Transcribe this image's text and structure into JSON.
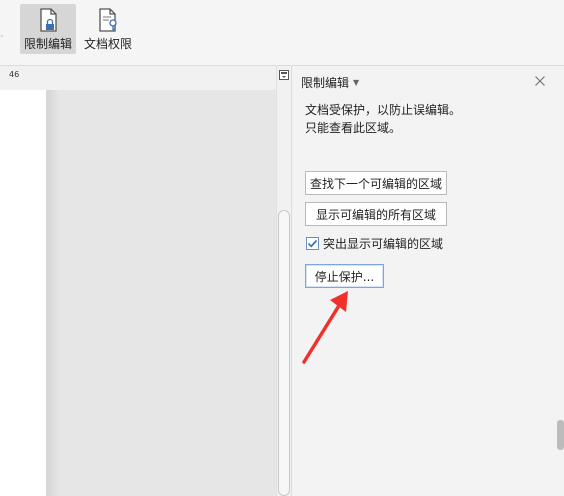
{
  "ribbon": {
    "separator": "-",
    "restrict_edit_label": "限制编辑",
    "doc_permission_label": "文档权限"
  },
  "ruler": {
    "number": "46"
  },
  "pane": {
    "title": "限制编辑",
    "desc_line1": "文档受保护，以防止误编辑。",
    "desc_line2": "只能查看此区域。",
    "find_next_label": "查找下一个可编辑的区域",
    "show_all_label": "显示可编辑的所有区域",
    "highlight_label": "突出显示可编辑的区域",
    "highlight_checked": true,
    "stop_protect_label": "停止保护..."
  },
  "colors": {
    "arrow": "#f0302a",
    "accent_border": "#7fa6d9",
    "check": "#3a6fb5"
  },
  "icons": {
    "restrict_edit": "document-lock-icon",
    "doc_permission": "document-key-icon",
    "close": "close-icon",
    "caret": "caret-down-icon",
    "pane_toggle": "pane-toggle-icon",
    "checkmark": "checkmark-icon"
  }
}
